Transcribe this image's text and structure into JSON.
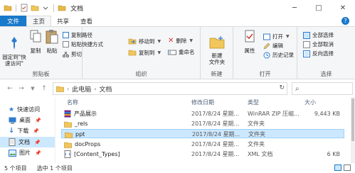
{
  "window": {
    "title": "文档",
    "controls": {
      "minimize": "─",
      "maximize": "□",
      "close": "✕"
    }
  },
  "ribbon_tabs": {
    "file": "文件",
    "home": "主页",
    "share": "共享",
    "view": "查看",
    "help": "?"
  },
  "clipboard": {
    "pin": "固定到\"快\n速访问\"",
    "copy": "复制",
    "paste": "粘贴",
    "copy_path": "复制路径",
    "paste_shortcut": "粘贴快捷方式",
    "cut": "剪切",
    "label": "剪贴板"
  },
  "organize": {
    "move_to": "移动到",
    "copy_to": "复制到",
    "delete": "删除",
    "rename": "重命名",
    "label": "组织"
  },
  "new_group": {
    "new_folder": "新建\n文件夹",
    "label": "新建"
  },
  "open_group": {
    "properties": "属性",
    "open": "打开",
    "edit": "编辑",
    "history": "历史记录",
    "label": "打开"
  },
  "select_group": {
    "select_all": "全部选择",
    "select_none": "全部取消",
    "invert": "反向选择",
    "label": "选择"
  },
  "address": {
    "crumbs": [
      "此电脑",
      "文档"
    ],
    "back": "←",
    "forward": "→",
    "up": "↑",
    "refresh": "↻",
    "search_icon": "⌕"
  },
  "nav_pane": {
    "items": [
      {
        "label": "快速访问",
        "icon": "star-icon",
        "pinned": false
      },
      {
        "label": "桌面",
        "icon": "desktop-icon",
        "pinned": true
      },
      {
        "label": "下载",
        "icon": "download-icon",
        "pinned": true
      },
      {
        "label": "文档",
        "icon": "document-icon",
        "pinned": true
      },
      {
        "label": "图片",
        "icon": "picture-icon",
        "pinned": true
      }
    ],
    "pin_glyph": "📌"
  },
  "file_list": {
    "columns": {
      "name": "名称",
      "date": "修改日期",
      "type": "类型",
      "size": "大小"
    },
    "rows": [
      {
        "name": "产品展示",
        "date": "2017/8/24 星期...",
        "type": "WinRAR ZIP 压缩...",
        "size": "9,443 KB",
        "icon": "archive-icon",
        "selected": false
      },
      {
        "name": "_rels",
        "date": "2017/8/24 星期...",
        "type": "文件夹",
        "size": "",
        "icon": "folder-icon",
        "selected": false
      },
      {
        "name": "ppt",
        "date": "2017/8/24 星期...",
        "type": "文件夹",
        "size": "",
        "icon": "folder-icon",
        "selected": true
      },
      {
        "name": "docProps",
        "date": "2017/8/24 星期...",
        "type": "文件夹",
        "size": "",
        "icon": "folder-icon",
        "selected": false
      },
      {
        "name": "[Content_Types]",
        "date": "2017/8/24 星期...",
        "type": "XML 文档",
        "size": "6 KB",
        "icon": "xml-file-icon",
        "selected": false
      }
    ]
  },
  "status_bar": {
    "item_count": "5 个项目",
    "selected": "选中 1 个项目"
  },
  "colors": {
    "accent": "#1979ca",
    "selection": "#cce8ff",
    "ribbon_bg": "#f5f6f7"
  }
}
